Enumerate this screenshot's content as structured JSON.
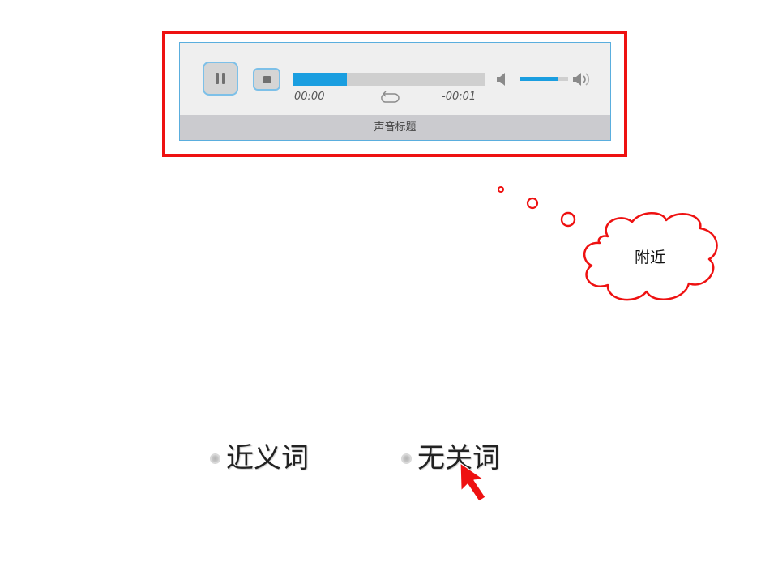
{
  "player": {
    "current_time": "00:00",
    "remaining_time": "-00:01",
    "progress": 0.28,
    "volume": 0.8,
    "title": "声音标题",
    "icons": {
      "pause": "pause-icon",
      "stop": "stop-icon",
      "loop": "loop-icon",
      "volume_low": "volume-low-icon",
      "volume_high": "volume-high-icon"
    }
  },
  "thought_bubble": {
    "text": "附近"
  },
  "options": [
    {
      "label": "近义词",
      "selected": false
    },
    {
      "label": "无关词",
      "selected": false
    }
  ],
  "colors": {
    "highlight": "#ee1111",
    "accent": "#1a9ee0",
    "player_border": "#5aaede"
  }
}
